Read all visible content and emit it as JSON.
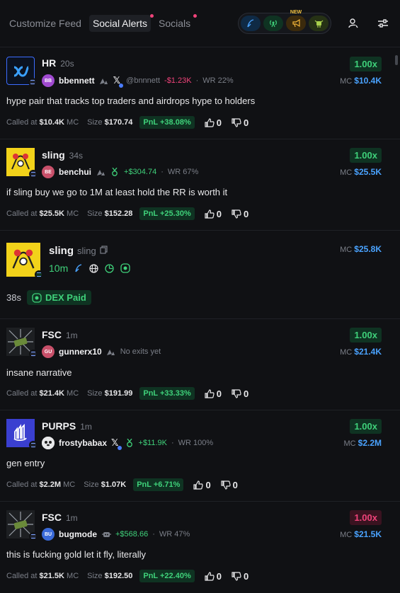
{
  "header": {
    "tabs": [
      {
        "label": "Customize Feed",
        "active": false,
        "dot": false
      },
      {
        "label": "Social Alerts",
        "active": true,
        "dot": true
      },
      {
        "label": "Socials",
        "active": false,
        "dot": true
      }
    ],
    "new_badge": "NEW"
  },
  "alerts": [
    {
      "token": "HR",
      "age": "20s",
      "user_initials": "BB",
      "user": "bbennett",
      "handle": "@bnnnett",
      "pnl_user": "-$1.23K",
      "wr": "WR 22%",
      "message": "hype pair that tracks top traders and airdrops hype to holders",
      "called_label": "Called at",
      "called_mc": "$10.4K",
      "mc_suffix": "MC",
      "size_label": "Size",
      "size": "$170.74",
      "pnl": "PnL +38.08%",
      "up": "0",
      "down": "0",
      "mult": "1.00x",
      "mc_label": "MC",
      "mc": "$10.4K"
    },
    {
      "token": "sling",
      "age": "34s",
      "user_initials": "BE",
      "user": "benchui",
      "pnl_user": "+$304.74",
      "wr": "WR 67%",
      "message": "if sling buy we go to 1M at least hold the RR is worth it",
      "called_label": "Called at",
      "called_mc": "$25.5K",
      "mc_suffix": "MC",
      "size_label": "Size",
      "size": "$152.28",
      "pnl": "PnL +25.30%",
      "up": "0",
      "down": "0",
      "mult": "1.00x",
      "mc_label": "MC",
      "mc": "$25.5K"
    },
    {
      "token": "FSC",
      "age": "1m",
      "user_initials": "GU",
      "user": "gunnerx10",
      "no_exits": "No exits yet",
      "message": "insane narrative",
      "called_label": "Called at",
      "called_mc": "$21.4K",
      "mc_suffix": "MC",
      "size_label": "Size",
      "size": "$191.99",
      "pnl": "PnL +33.33%",
      "up": "0",
      "down": "0",
      "mult": "1.00x",
      "mc_label": "MC",
      "mc": "$21.4K"
    },
    {
      "token": "PURPS",
      "age": "1m",
      "user": "frostybabax",
      "pnl_user": "+$11.9K",
      "wr": "WR 100%",
      "message": "gen entry",
      "called_label": "Called at",
      "called_mc": "$2.2M",
      "mc_suffix": "MC",
      "size_label": "Size",
      "size": "$1.07K",
      "pnl": "PnL +6.71%",
      "up": "0",
      "down": "0",
      "mult": "1.00x",
      "mc_label": "MC",
      "mc": "$2.2M"
    },
    {
      "token": "FSC",
      "age": "1m",
      "user_initials": "BU",
      "user": "bugmode",
      "pnl_user": "+$568.66",
      "wr": "WR 47%",
      "message": "this is fucking gold let it fly, literally",
      "called_label": "Called at",
      "called_mc": "$21.5K",
      "mc_suffix": "MC",
      "size_label": "Size",
      "size": "$192.50",
      "pnl": "PnL +22.40%",
      "up": "0",
      "down": "0",
      "mult": "1.00x",
      "mc_label": "MC",
      "mc": "$21.5K"
    }
  ],
  "pair": {
    "name": "sling",
    "ticker": "sling",
    "age": "10m",
    "mc_label": "MC",
    "mc": "$25.8K",
    "time": "38s",
    "dex": "DEX Paid"
  },
  "colors": {
    "accent_green": "#3fd17a",
    "accent_red": "#f0437a",
    "accent_blue": "#4aa3ff",
    "bg": "#101114"
  }
}
